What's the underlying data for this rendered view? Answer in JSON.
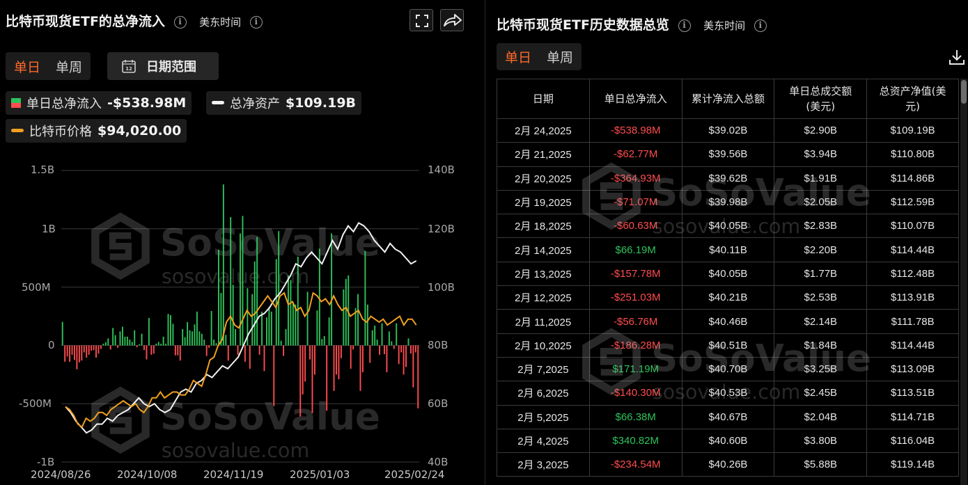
{
  "left": {
    "title": "比特币现货ETF的总净流入",
    "timezone": "美东时间",
    "info_glyph": "i",
    "tabs": [
      "单日",
      "单周"
    ],
    "date_range_label": "日期范围",
    "legend": {
      "inflow_label": "单日总净流入",
      "inflow_value": "-$538.98M",
      "assets_label": "总净资产",
      "assets_value": "$109.19B",
      "price_label": "比特币价格",
      "price_value": "$94,020.00"
    },
    "icons": {
      "fullscreen": "fullscreen-icon",
      "share": "share-icon",
      "calendar": "calendar-icon"
    }
  },
  "right": {
    "title": "比特币现货ETF历史数据总览",
    "timezone": "美东时间",
    "tabs": [
      "单日",
      "单周"
    ],
    "download_icon": "download-icon",
    "columns": [
      "日期",
      "单日总净流入",
      "累计净流入总额",
      "单日总成交额\n(美元)",
      "总资产净值(美\n元)"
    ],
    "rows": [
      [
        "2月 24,2025",
        "-$538.98M",
        "$39.02B",
        "$2.90B",
        "$109.19B"
      ],
      [
        "2月 21,2025",
        "-$62.77M",
        "$39.56B",
        "$3.94B",
        "$110.80B"
      ],
      [
        "2月 20,2025",
        "-$364.93M",
        "$39.62B",
        "$1.91B",
        "$114.86B"
      ],
      [
        "2月 19,2025",
        "-$71.07M",
        "$39.98B",
        "$2.05B",
        "$112.59B"
      ],
      [
        "2月 18,2025",
        "-$60.63M",
        "$40.05B",
        "$2.83B",
        "$110.07B"
      ],
      [
        "2月 14,2025",
        "$66.19M",
        "$40.11B",
        "$2.20B",
        "$114.44B"
      ],
      [
        "2月 13,2025",
        "-$157.78M",
        "$40.05B",
        "$1.77B",
        "$112.48B"
      ],
      [
        "2月 12,2025",
        "-$251.03M",
        "$40.21B",
        "$2.53B",
        "$113.91B"
      ],
      [
        "2月 11,2025",
        "-$56.76M",
        "$40.46B",
        "$2.14B",
        "$111.78B"
      ],
      [
        "2月 10,2025",
        "-$186.28M",
        "$40.51B",
        "$1.84B",
        "$114.44B"
      ],
      [
        "2月 7,2025",
        "$171.19M",
        "$40.70B",
        "$3.25B",
        "$113.09B"
      ],
      [
        "2月 6,2025",
        "-$140.30M",
        "$40.53B",
        "$2.45B",
        "$113.51B"
      ],
      [
        "2月 5,2025",
        "$66.38M",
        "$40.67B",
        "$2.04B",
        "$114.71B"
      ],
      [
        "2月 4,2025",
        "$340.82M",
        "$40.60B",
        "$3.80B",
        "$116.04B"
      ],
      [
        "2月 3,2025",
        "-$234.54M",
        "$40.26B",
        "$5.88B",
        "$119.14B"
      ]
    ]
  },
  "watermark": {
    "brand": "SoSoValue",
    "site": "sosovalue.com"
  },
  "colors": {
    "accent": "#ff6a2a",
    "positive": "#2ec25b",
    "negative": "#ff4d4f",
    "btc_price": "#f0a020",
    "net_assets": "#f2f2f2"
  },
  "chart_data": {
    "type": "bar",
    "title": "比特币现货ETF的总净流入",
    "x_ticks": [
      "2024/08/26",
      "2024/10/08",
      "2024/11/19",
      "2025/01/03",
      "2025/02/24"
    ],
    "y_left_ticks": [
      "1.5B",
      "1B",
      "500M",
      "0",
      "-500M",
      "-1B"
    ],
    "y_left_range": [
      -1000,
      1500
    ],
    "y_right_ticks": [
      "140B",
      "120B",
      "100B",
      "80B",
      "60B",
      "40B"
    ],
    "y_right_range": [
      40,
      140
    ],
    "series": [
      {
        "name": "单日总净流入",
        "type": "bar",
        "unit": "M USD",
        "values": [
          202,
          -140,
          -95,
          -140,
          -80,
          -125,
          -205,
          -145,
          -130,
          -60,
          -105,
          -80,
          -45,
          -40,
          -105,
          -70,
          -30,
          15,
          28,
          60,
          -35,
          150,
          88,
          -20,
          120,
          160,
          75,
          75,
          50,
          30,
          130,
          -15,
          10,
          100,
          -40,
          -120,
          235,
          -80,
          -70,
          15,
          30,
          15,
          75,
          15,
          270,
          260,
          185,
          -85,
          -85,
          -130,
          140,
          70,
          200,
          130,
          120,
          180,
          290,
          120,
          100,
          50,
          -90,
          -20,
          295,
          50,
          20,
          820,
          450,
          1380,
          90,
          -130,
          1100,
          520,
          140,
          -80,
          960,
          1110,
          -140,
          490,
          -200,
          440,
          720,
          930,
          -80,
          290,
          -220,
          240,
          330,
          290,
          -520,
          740,
          980,
          40,
          -90,
          140,
          600,
          560,
          370,
          350,
          760,
          -610,
          -420,
          -310,
          460,
          -120,
          -580,
          -250,
          300,
          830,
          55,
          80,
          -560,
          240,
          960,
          -390,
          -250,
          -290,
          -110,
          480,
          570,
          600,
          -200,
          -35,
          320,
          440,
          -390,
          -230,
          810,
          350,
          -150,
          130,
          170,
          50,
          -80,
          190,
          -75,
          -230,
          120,
          35,
          -30,
          190,
          -160,
          -60,
          -250,
          -185,
          60,
          -70,
          -360,
          -60,
          -540
        ]
      },
      {
        "name": "总净资产",
        "type": "line",
        "unit": "B USD",
        "values": [
          59,
          57,
          54,
          52,
          50,
          51,
          53,
          53,
          55,
          54,
          56,
          57,
          58,
          60,
          62,
          60,
          59,
          60,
          58,
          57,
          58,
          61,
          64,
          65,
          64,
          67,
          68,
          70,
          69,
          71,
          73,
          72,
          74,
          76,
          80,
          84,
          87,
          90,
          91,
          93,
          96,
          98,
          101,
          104,
          108,
          107,
          110,
          112,
          110,
          108,
          112,
          116,
          113,
          118,
          121,
          119,
          122,
          121,
          119,
          116,
          114,
          112,
          115,
          113,
          112,
          110,
          108,
          109
        ]
      },
      {
        "name": "比特币价格",
        "type": "line",
        "unit": "B (right axis)",
        "values": [
          59,
          58,
          56,
          53,
          52,
          55,
          54,
          55,
          57,
          57,
          56,
          58,
          59,
          60,
          61,
          60,
          59,
          60,
          58,
          57,
          59,
          62,
          62,
          64,
          62,
          63,
          64,
          64,
          63,
          63,
          65,
          68,
          67,
          66,
          70,
          75,
          76,
          80,
          82,
          88,
          90,
          87,
          86,
          89,
          92,
          90,
          91,
          93,
          95,
          97,
          95,
          93,
          97,
          98,
          94,
          95,
          92,
          93,
          90,
          92,
          98,
          97,
          95,
          96,
          94,
          97,
          94,
          92,
          93,
          90,
          91,
          92,
          89,
          88,
          90,
          89,
          88,
          89,
          87,
          88,
          89,
          90,
          87,
          89,
          89,
          87
        ]
      }
    ]
  }
}
